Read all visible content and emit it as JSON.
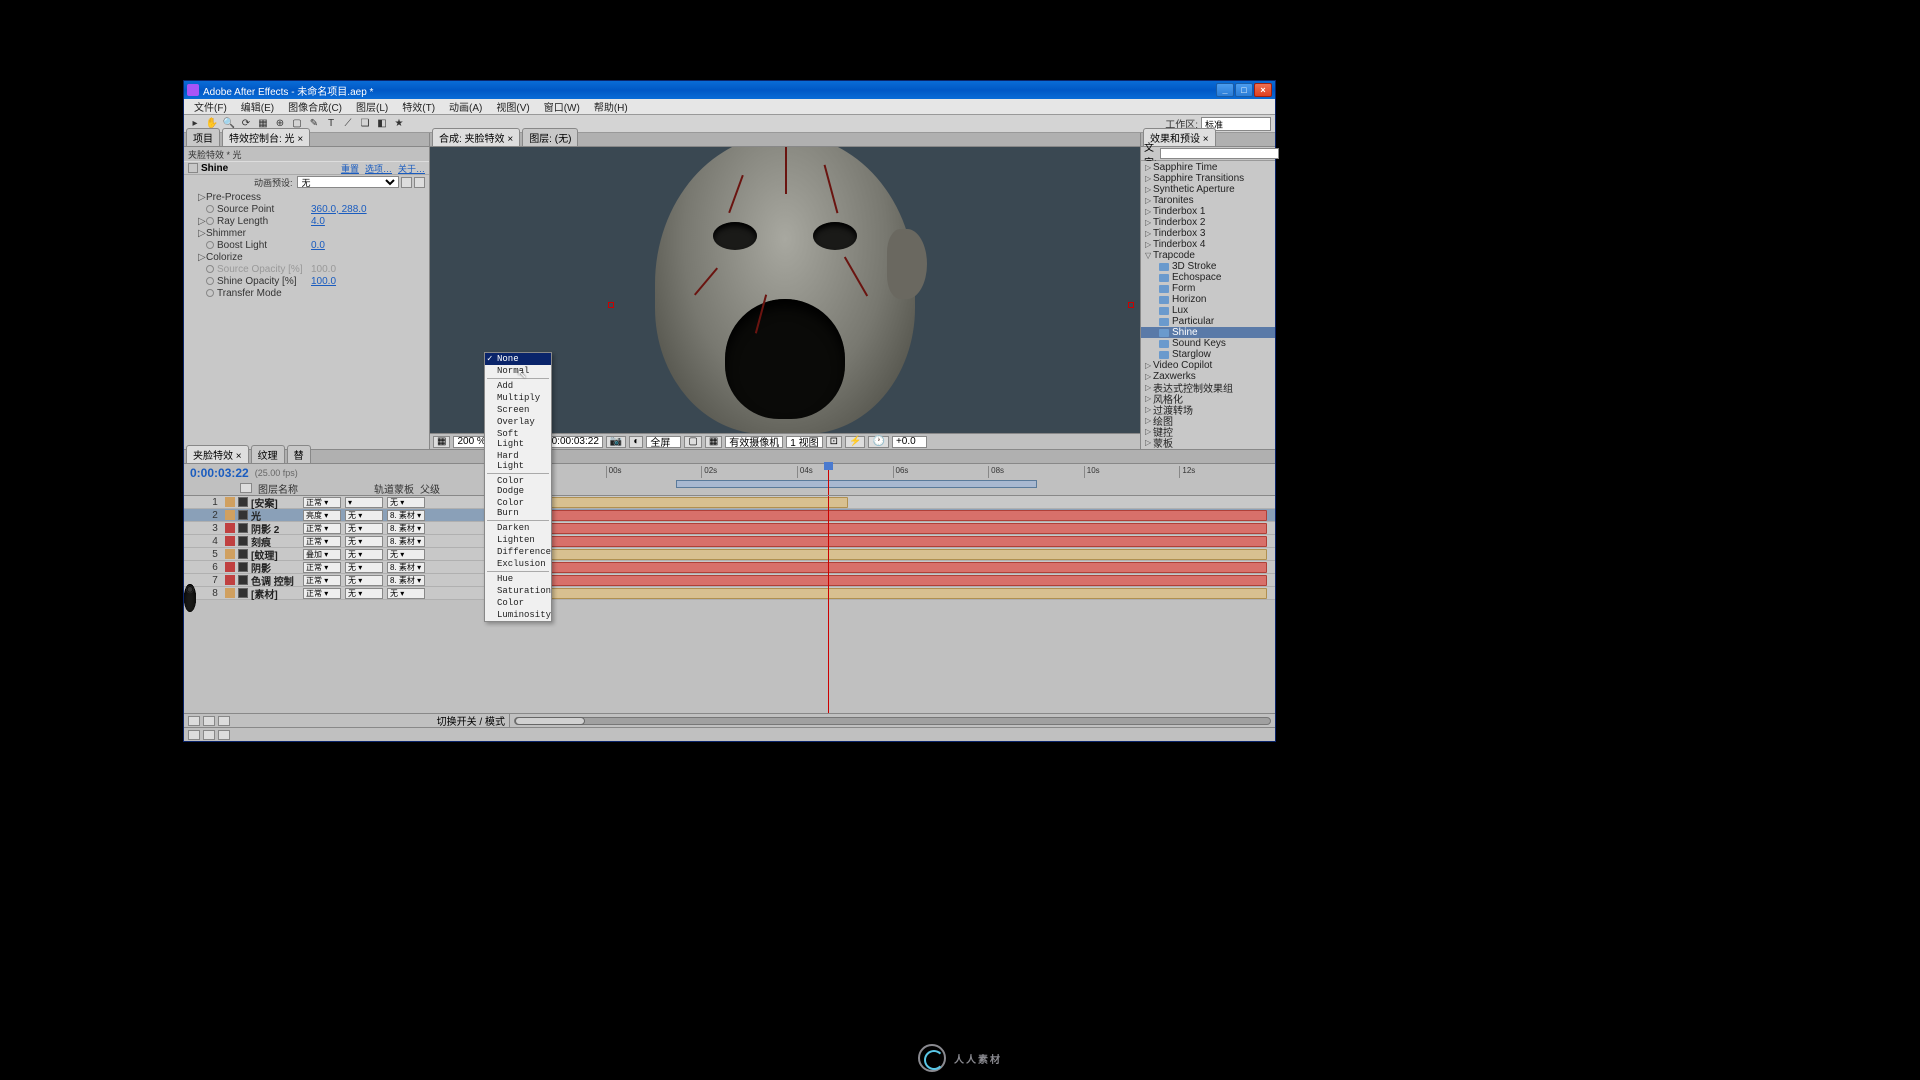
{
  "window": {
    "title": "Adobe After Effects - 未命名项目.aep *",
    "min": "_",
    "max": "□",
    "close": "×"
  },
  "menubar": [
    "文件(F)",
    "编辑(E)",
    "图像合成(C)",
    "图层(L)",
    "特效(T)",
    "动画(A)",
    "视图(V)",
    "窗口(W)",
    "帮助(H)"
  ],
  "workspace": {
    "label": "工作区:",
    "value": "标准"
  },
  "left": {
    "tabs": [
      "项目",
      "特效控制台: 光 ×"
    ],
    "panel_title": "夹脸特效 * 光",
    "effect": {
      "name": "Shine",
      "reset": "重置",
      "option": "选项…",
      "about": "关于…"
    },
    "preset": {
      "label": "动画预设:",
      "value": "无"
    },
    "props": [
      {
        "tri": "▷",
        "label": "Pre-Process",
        "val": ""
      },
      {
        "tri": "",
        "stop": true,
        "label": "Source Point",
        "val": "360.0, 288.0"
      },
      {
        "tri": "▷",
        "stop": true,
        "label": "Ray Length",
        "val": "4.0"
      },
      {
        "tri": "▷",
        "label": "Shimmer",
        "val": ""
      },
      {
        "tri": "",
        "stop": true,
        "label": "Boost Light",
        "val": "0.0"
      },
      {
        "tri": "▷",
        "label": "Colorize",
        "val": ""
      },
      {
        "tri": "",
        "stop": true,
        "label": "Source Opacity [%]",
        "val": "100.0",
        "disabled": true
      },
      {
        "tri": "",
        "stop": true,
        "label": "Shine Opacity [%]",
        "val": "100.0"
      },
      {
        "tri": "",
        "stop": true,
        "label": "Transfer Mode",
        "val": ""
      }
    ]
  },
  "dropdown": {
    "groups": [
      [
        "None",
        "Normal"
      ],
      [
        "Add",
        "Multiply",
        "Screen",
        "Overlay",
        "Soft Light",
        "Hard Light"
      ],
      [
        "Color Dodge",
        "Color Burn"
      ],
      [
        "Darken",
        "Lighten",
        "Difference",
        "Exclusion"
      ],
      [
        "Hue",
        "Saturation",
        "Color",
        "Luminosity"
      ]
    ],
    "selected": "None"
  },
  "center": {
    "tabs": [
      "合成: 夹脸特效 ×",
      "图层: (无)"
    ],
    "controls": {
      "zoom": "200 %",
      "tc": "0:00:03:22",
      "full": "全屏",
      "cam": "有效摄像机",
      "view": "1 视图",
      "fast": "+0.0"
    }
  },
  "right": {
    "tab": "效果和预设 ×",
    "search_label": "文字:",
    "placeholder": "",
    "items": [
      {
        "t": "▷",
        "label": "Sapphire Time"
      },
      {
        "t": "▷",
        "label": "Sapphire Transitions"
      },
      {
        "t": "▷",
        "label": "Synthetic Aperture"
      },
      {
        "t": "▷",
        "label": "Taronites"
      },
      {
        "t": "▷",
        "label": "Tinderbox 1"
      },
      {
        "t": "▷",
        "label": "Tinderbox 2"
      },
      {
        "t": "▷",
        "label": "Tinderbox 3"
      },
      {
        "t": "▷",
        "label": "Tinderbox 4"
      },
      {
        "t": "▽",
        "label": "Trapcode",
        "children": [
          {
            "label": "3D Stroke"
          },
          {
            "label": "Echospace"
          },
          {
            "label": "Form"
          },
          {
            "label": "Horizon"
          },
          {
            "label": "Lux"
          },
          {
            "label": "Particular"
          },
          {
            "label": "Shine",
            "sel": true
          },
          {
            "label": "Sound Keys"
          },
          {
            "label": "Starglow"
          }
        ]
      },
      {
        "t": "▷",
        "label": "Video Copilot"
      },
      {
        "t": "▷",
        "label": "Zaxwerks"
      },
      {
        "t": "▷",
        "label": "表达式控制效果组"
      },
      {
        "t": "▷",
        "label": "风格化"
      },
      {
        "t": "▷",
        "label": "过渡转场"
      },
      {
        "t": "▷",
        "label": "绘图"
      },
      {
        "t": "▷",
        "label": "键控"
      },
      {
        "t": "▷",
        "label": "蒙板"
      }
    ]
  },
  "timeline": {
    "tab": "夹脸特效 ×",
    "tab2": "纹理",
    "tab3": "替",
    "tc": "0:00:03:22",
    "fps": "(25.00 fps)",
    "cols": {
      "name": "图层名称",
      "trk": "轨道蒙板",
      "par": "父级"
    },
    "marks": [
      "",
      "00s",
      "02s",
      "04s",
      "06s",
      "08s",
      "10s",
      "12s"
    ],
    "layers": [
      {
        "n": "1",
        "c": "#d0a060",
        "name": "[安案]",
        "mode": "正常",
        "trk": "",
        "par": "无",
        "red": false,
        "short": true
      },
      {
        "n": "2",
        "c": "#d0a060",
        "name": "光",
        "mode": "亮度",
        "trk": "无",
        "par": "8. 素材",
        "red": true,
        "sel": true
      },
      {
        "n": "3",
        "c": "#c04040",
        "name": "阴影 2",
        "mode": "正常",
        "trk": "无",
        "par": "8. 素材",
        "red": true
      },
      {
        "n": "4",
        "c": "#c04040",
        "name": "刻痕",
        "mode": "正常",
        "trk": "无",
        "par": "8. 素材",
        "red": true
      },
      {
        "n": "5",
        "c": "#d0a060",
        "name": "[蚊理]",
        "mode": "叠加",
        "trk": "无",
        "par": "无",
        "red": false
      },
      {
        "n": "6",
        "c": "#c04040",
        "name": "阴影",
        "mode": "正常",
        "trk": "无",
        "par": "8. 素材",
        "red": true
      },
      {
        "n": "7",
        "c": "#c04040",
        "name": "色调 控制",
        "mode": "正常",
        "trk": "无",
        "par": "8. 素材",
        "red": true
      },
      {
        "n": "8",
        "c": "#d0a060",
        "name": "[素材]",
        "mode": "正常",
        "trk": "无",
        "par": "无",
        "red": false
      }
    ],
    "toggle": "切换开关 / 模式"
  },
  "watermark": "人人素材"
}
